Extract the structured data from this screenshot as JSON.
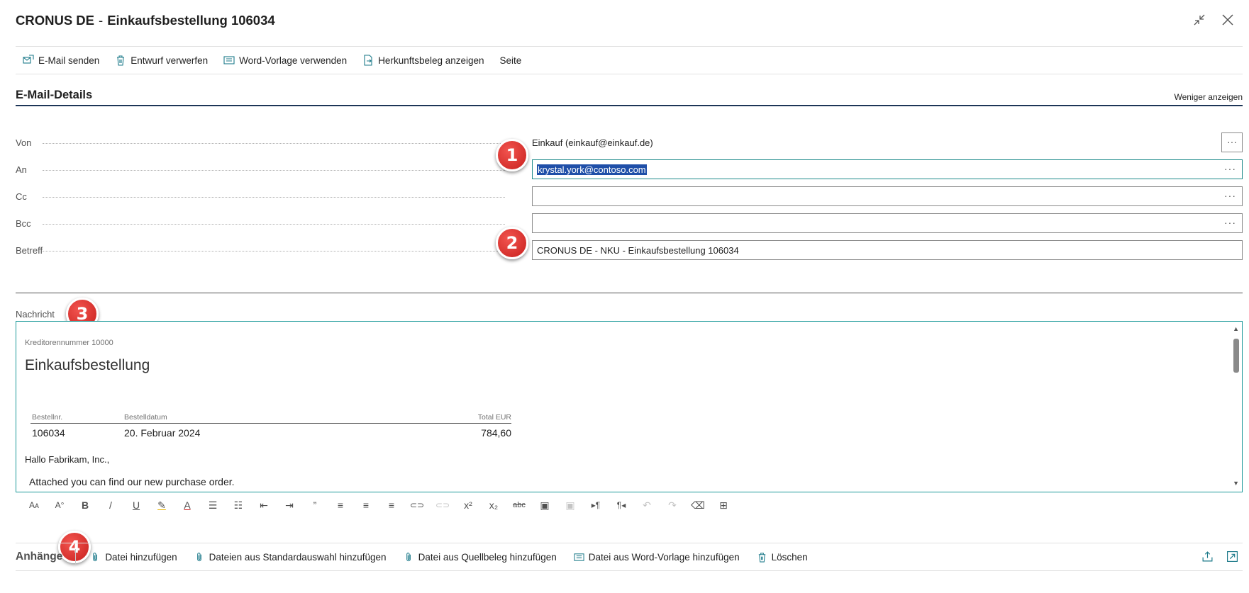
{
  "window": {
    "company": "CRONUS DE",
    "separator": "-",
    "doc_title": "Einkaufsbestellung 106034",
    "collapse_icon": "collapse-icon",
    "close_icon": "close-icon"
  },
  "actions": [
    {
      "label": "E-Mail senden",
      "icon": "send-mail-icon"
    },
    {
      "label": "Entwurf verwerfen",
      "icon": "trash-icon"
    },
    {
      "label": "Word-Vorlage verwenden",
      "icon": "word-template-icon"
    },
    {
      "label": "Herkunftsbeleg anzeigen",
      "icon": "source-document-icon"
    },
    {
      "label": "Seite",
      "icon": ""
    }
  ],
  "details": {
    "title": "E-Mail-Details",
    "show_less": "Weniger anzeigen",
    "fields": {
      "from": {
        "label": "Von",
        "value": "Einkauf (einkauf@einkauf.de)"
      },
      "to": {
        "label": "An",
        "value": "krystal.york@contoso.com"
      },
      "cc": {
        "label": "Cc",
        "value": ""
      },
      "bcc": {
        "label": "Bcc",
        "value": ""
      },
      "subject": {
        "label": "Betreff",
        "value": "CRONUS DE - NKU - Einkaufsbestellung 106034"
      }
    },
    "more_glyph": "···"
  },
  "badges": [
    "1",
    "2",
    "3",
    "4"
  ],
  "message": {
    "label": "Nachricht",
    "vendor_no": "Kreditorennummer 10000",
    "heading": "Einkaufsbestellung",
    "table": {
      "headers": [
        "Bestellnr.",
        "Bestelldatum",
        "Total EUR"
      ],
      "row": [
        "106034",
        "20. Februar 2024",
        "784,60"
      ]
    },
    "greeting": "Hallo Fabrikam, Inc.,",
    "body": "Attached you can find our new purchase order."
  },
  "format_toolbar": [
    {
      "glyph": "Aᴀ",
      "name": "font-size-icon",
      "disabled": false
    },
    {
      "glyph": "A°",
      "name": "font-color-swatch-icon",
      "disabled": false
    },
    {
      "glyph": "B",
      "name": "bold-icon",
      "disabled": false
    },
    {
      "glyph": "/",
      "name": "italic-icon",
      "disabled": false
    },
    {
      "glyph": "U",
      "name": "underline-icon",
      "disabled": false
    },
    {
      "glyph": "✎",
      "name": "highlight-icon",
      "disabled": false
    },
    {
      "glyph": "A",
      "name": "text-color-icon",
      "disabled": false
    },
    {
      "glyph": "☰",
      "name": "bullet-list-icon",
      "disabled": false
    },
    {
      "glyph": "☷",
      "name": "numbered-list-icon",
      "disabled": false
    },
    {
      "glyph": "⇤",
      "name": "outdent-icon",
      "disabled": false
    },
    {
      "glyph": "⇥",
      "name": "indent-icon",
      "disabled": false
    },
    {
      "glyph": "”",
      "name": "quote-icon",
      "disabled": false
    },
    {
      "glyph": "≡",
      "name": "align-left-icon",
      "disabled": false
    },
    {
      "glyph": "≡",
      "name": "align-center-icon",
      "disabled": false
    },
    {
      "glyph": "≡",
      "name": "align-right-icon",
      "disabled": false
    },
    {
      "glyph": "⊂⊃",
      "name": "link-icon",
      "disabled": false
    },
    {
      "glyph": "⊂⊃",
      "name": "unlink-icon",
      "disabled": true
    },
    {
      "glyph": "x²",
      "name": "superscript-icon",
      "disabled": false
    },
    {
      "glyph": "x₂",
      "name": "subscript-icon",
      "disabled": false
    },
    {
      "glyph": "abc",
      "name": "strikethrough-icon",
      "disabled": false
    },
    {
      "glyph": "▣",
      "name": "insert-image-icon",
      "disabled": false
    },
    {
      "glyph": "▣",
      "name": "edit-image-icon",
      "disabled": true
    },
    {
      "glyph": "▸¶",
      "name": "ltr-icon",
      "disabled": false
    },
    {
      "glyph": "¶◂",
      "name": "rtl-icon",
      "disabled": false
    },
    {
      "glyph": "↶",
      "name": "undo-icon",
      "disabled": true
    },
    {
      "glyph": "↷",
      "name": "redo-icon",
      "disabled": true
    },
    {
      "glyph": "⌫",
      "name": "clear-format-icon",
      "disabled": false
    },
    {
      "glyph": "⊞",
      "name": "table-icon",
      "disabled": false
    }
  ],
  "attachments": {
    "title": "Anhänge",
    "actions": [
      {
        "label": "Datei hinzufügen",
        "icon": "paperclip-icon"
      },
      {
        "label": "Dateien aus Standardauswahl hinzufügen",
        "icon": "paperclip-icon"
      },
      {
        "label": "Datei aus Quellbeleg hinzufügen",
        "icon": "paperclip-icon"
      },
      {
        "label": "Datei aus Word-Vorlage hinzufügen",
        "icon": "word-template-icon"
      },
      {
        "label": "Löschen",
        "icon": "trash-icon"
      }
    ],
    "right_icons": [
      "share-icon",
      "expand-icon"
    ]
  },
  "colors": {
    "accent": "#1c9a9a",
    "badge": "#d8302b",
    "selection": "#1f4fa8",
    "section_rule": "#1d3557"
  }
}
